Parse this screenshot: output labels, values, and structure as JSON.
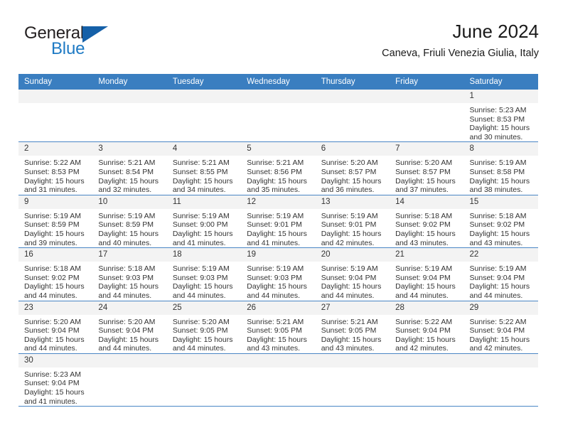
{
  "brand": {
    "name_top": "General",
    "name_bottom": "Blue",
    "accent_color": "#1560a8",
    "text_color": "#231f20",
    "blue_text_color": "#1e7ac4",
    "triangle_icon": "triangle-icon"
  },
  "header": {
    "title": "June 2024",
    "subtitle": "Caneva, Friuli Venezia Giulia, Italy"
  },
  "theme": {
    "header_row_bg": "#3a7ec0",
    "header_row_text": "#ffffff",
    "daynum_bg": "#f3f3f3",
    "row_divider": "#4a86c5",
    "body_text": "#333333"
  },
  "weekdays": [
    "Sunday",
    "Monday",
    "Tuesday",
    "Wednesday",
    "Thursday",
    "Friday",
    "Saturday"
  ],
  "labels": {
    "sunrise_prefix": "Sunrise:",
    "sunset_prefix": "Sunset:",
    "daylight_prefix": "Daylight:"
  },
  "weeks": [
    [
      {
        "day": "",
        "blank": true
      },
      {
        "day": "",
        "blank": true
      },
      {
        "day": "",
        "blank": true
      },
      {
        "day": "",
        "blank": true
      },
      {
        "day": "",
        "blank": true
      },
      {
        "day": "",
        "blank": true
      },
      {
        "day": "1",
        "line1": "Sunrise: 5:23 AM",
        "line2": "Sunset: 8:53 PM",
        "line3": "Daylight: 15 hours",
        "line4": "and 30 minutes."
      }
    ],
    [
      {
        "day": "2",
        "line1": "Sunrise: 5:22 AM",
        "line2": "Sunset: 8:53 PM",
        "line3": "Daylight: 15 hours",
        "line4": "and 31 minutes."
      },
      {
        "day": "3",
        "line1": "Sunrise: 5:21 AM",
        "line2": "Sunset: 8:54 PM",
        "line3": "Daylight: 15 hours",
        "line4": "and 32 minutes."
      },
      {
        "day": "4",
        "line1": "Sunrise: 5:21 AM",
        "line2": "Sunset: 8:55 PM",
        "line3": "Daylight: 15 hours",
        "line4": "and 34 minutes."
      },
      {
        "day": "5",
        "line1": "Sunrise: 5:21 AM",
        "line2": "Sunset: 8:56 PM",
        "line3": "Daylight: 15 hours",
        "line4": "and 35 minutes."
      },
      {
        "day": "6",
        "line1": "Sunrise: 5:20 AM",
        "line2": "Sunset: 8:57 PM",
        "line3": "Daylight: 15 hours",
        "line4": "and 36 minutes."
      },
      {
        "day": "7",
        "line1": "Sunrise: 5:20 AM",
        "line2": "Sunset: 8:57 PM",
        "line3": "Daylight: 15 hours",
        "line4": "and 37 minutes."
      },
      {
        "day": "8",
        "line1": "Sunrise: 5:19 AM",
        "line2": "Sunset: 8:58 PM",
        "line3": "Daylight: 15 hours",
        "line4": "and 38 minutes."
      }
    ],
    [
      {
        "day": "9",
        "line1": "Sunrise: 5:19 AM",
        "line2": "Sunset: 8:59 PM",
        "line3": "Daylight: 15 hours",
        "line4": "and 39 minutes."
      },
      {
        "day": "10",
        "line1": "Sunrise: 5:19 AM",
        "line2": "Sunset: 8:59 PM",
        "line3": "Daylight: 15 hours",
        "line4": "and 40 minutes."
      },
      {
        "day": "11",
        "line1": "Sunrise: 5:19 AM",
        "line2": "Sunset: 9:00 PM",
        "line3": "Daylight: 15 hours",
        "line4": "and 41 minutes."
      },
      {
        "day": "12",
        "line1": "Sunrise: 5:19 AM",
        "line2": "Sunset: 9:01 PM",
        "line3": "Daylight: 15 hours",
        "line4": "and 41 minutes."
      },
      {
        "day": "13",
        "line1": "Sunrise: 5:19 AM",
        "line2": "Sunset: 9:01 PM",
        "line3": "Daylight: 15 hours",
        "line4": "and 42 minutes."
      },
      {
        "day": "14",
        "line1": "Sunrise: 5:18 AM",
        "line2": "Sunset: 9:02 PM",
        "line3": "Daylight: 15 hours",
        "line4": "and 43 minutes."
      },
      {
        "day": "15",
        "line1": "Sunrise: 5:18 AM",
        "line2": "Sunset: 9:02 PM",
        "line3": "Daylight: 15 hours",
        "line4": "and 43 minutes."
      }
    ],
    [
      {
        "day": "16",
        "line1": "Sunrise: 5:18 AM",
        "line2": "Sunset: 9:02 PM",
        "line3": "Daylight: 15 hours",
        "line4": "and 44 minutes."
      },
      {
        "day": "17",
        "line1": "Sunrise: 5:18 AM",
        "line2": "Sunset: 9:03 PM",
        "line3": "Daylight: 15 hours",
        "line4": "and 44 minutes."
      },
      {
        "day": "18",
        "line1": "Sunrise: 5:19 AM",
        "line2": "Sunset: 9:03 PM",
        "line3": "Daylight: 15 hours",
        "line4": "and 44 minutes."
      },
      {
        "day": "19",
        "line1": "Sunrise: 5:19 AM",
        "line2": "Sunset: 9:03 PM",
        "line3": "Daylight: 15 hours",
        "line4": "and 44 minutes."
      },
      {
        "day": "20",
        "line1": "Sunrise: 5:19 AM",
        "line2": "Sunset: 9:04 PM",
        "line3": "Daylight: 15 hours",
        "line4": "and 44 minutes."
      },
      {
        "day": "21",
        "line1": "Sunrise: 5:19 AM",
        "line2": "Sunset: 9:04 PM",
        "line3": "Daylight: 15 hours",
        "line4": "and 44 minutes."
      },
      {
        "day": "22",
        "line1": "Sunrise: 5:19 AM",
        "line2": "Sunset: 9:04 PM",
        "line3": "Daylight: 15 hours",
        "line4": "and 44 minutes."
      }
    ],
    [
      {
        "day": "23",
        "line1": "Sunrise: 5:20 AM",
        "line2": "Sunset: 9:04 PM",
        "line3": "Daylight: 15 hours",
        "line4": "and 44 minutes."
      },
      {
        "day": "24",
        "line1": "Sunrise: 5:20 AM",
        "line2": "Sunset: 9:04 PM",
        "line3": "Daylight: 15 hours",
        "line4": "and 44 minutes."
      },
      {
        "day": "25",
        "line1": "Sunrise: 5:20 AM",
        "line2": "Sunset: 9:05 PM",
        "line3": "Daylight: 15 hours",
        "line4": "and 44 minutes."
      },
      {
        "day": "26",
        "line1": "Sunrise: 5:21 AM",
        "line2": "Sunset: 9:05 PM",
        "line3": "Daylight: 15 hours",
        "line4": "and 43 minutes."
      },
      {
        "day": "27",
        "line1": "Sunrise: 5:21 AM",
        "line2": "Sunset: 9:05 PM",
        "line3": "Daylight: 15 hours",
        "line4": "and 43 minutes."
      },
      {
        "day": "28",
        "line1": "Sunrise: 5:22 AM",
        "line2": "Sunset: 9:04 PM",
        "line3": "Daylight: 15 hours",
        "line4": "and 42 minutes."
      },
      {
        "day": "29",
        "line1": "Sunrise: 5:22 AM",
        "line2": "Sunset: 9:04 PM",
        "line3": "Daylight: 15 hours",
        "line4": "and 42 minutes."
      }
    ],
    [
      {
        "day": "30",
        "line1": "Sunrise: 5:23 AM",
        "line2": "Sunset: 9:04 PM",
        "line3": "Daylight: 15 hours",
        "line4": "and 41 minutes."
      },
      {
        "day": "",
        "blank": true
      },
      {
        "day": "",
        "blank": true
      },
      {
        "day": "",
        "blank": true
      },
      {
        "day": "",
        "blank": true
      },
      {
        "day": "",
        "blank": true
      },
      {
        "day": "",
        "blank": true
      }
    ]
  ]
}
